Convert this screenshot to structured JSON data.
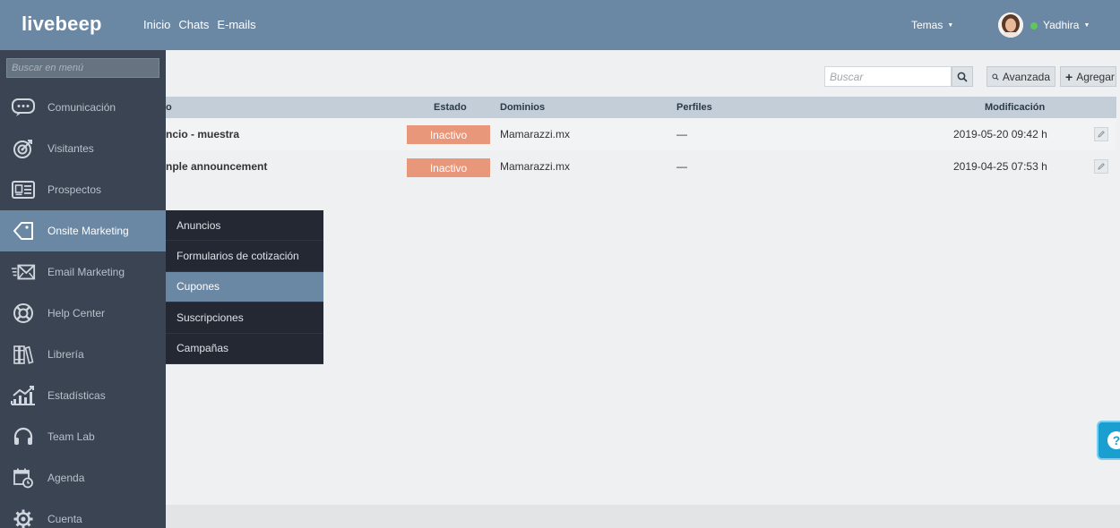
{
  "app": {
    "logo": "livebeep"
  },
  "topnav": [
    "Inicio",
    "Chats",
    "E-mails"
  ],
  "header": {
    "themes_label": "Temas",
    "user_name": "Yadhira",
    "online_color": "#5cc75c"
  },
  "sidebar": {
    "search_placeholder": "Buscar en menú",
    "items": [
      {
        "label": "Comunicación",
        "icon": "chat-bubble-icon"
      },
      {
        "label": "Visitantes",
        "icon": "target-icon"
      },
      {
        "label": "Prospectos",
        "icon": "id-card-icon"
      },
      {
        "label": "Onsite Marketing",
        "icon": "tag-icon",
        "active": true
      },
      {
        "label": "Email Marketing",
        "icon": "envelope-icon"
      },
      {
        "label": "Help Center",
        "icon": "lifebuoy-icon"
      },
      {
        "label": "Librería",
        "icon": "books-icon"
      },
      {
        "label": "Estadísticas",
        "icon": "chart-icon"
      },
      {
        "label": "Team Lab",
        "icon": "headset-icon"
      },
      {
        "label": "Agenda",
        "icon": "calendar-icon"
      },
      {
        "label": "Cuenta",
        "icon": "gear-icon"
      }
    ]
  },
  "submenu": {
    "items": [
      "Anuncios",
      "Formularios de cotización",
      "Cupones",
      "Suscripciones",
      "Campañas"
    ],
    "active_index": 2
  },
  "toolbar": {
    "search_placeholder": "Buscar",
    "advanced_label": "Avanzada",
    "add_label": "Agregar"
  },
  "table": {
    "headers": {
      "name": "o",
      "status": "Estado",
      "domains": "Dominios",
      "profiles": "Perfiles",
      "modified": "Modificación"
    },
    "rows": [
      {
        "name": "ncio - muestra",
        "status": "Inactivo",
        "domain": "Mamarazzi.mx",
        "profiles": "—",
        "modified": "2019-05-20 09:42 h"
      },
      {
        "name": "nple announcement",
        "status": "Inactivo",
        "domain": "Mamarazzi.mx",
        "profiles": "—",
        "modified": "2019-04-25 07:53 h"
      }
    ]
  },
  "help": {
    "label": "?"
  }
}
